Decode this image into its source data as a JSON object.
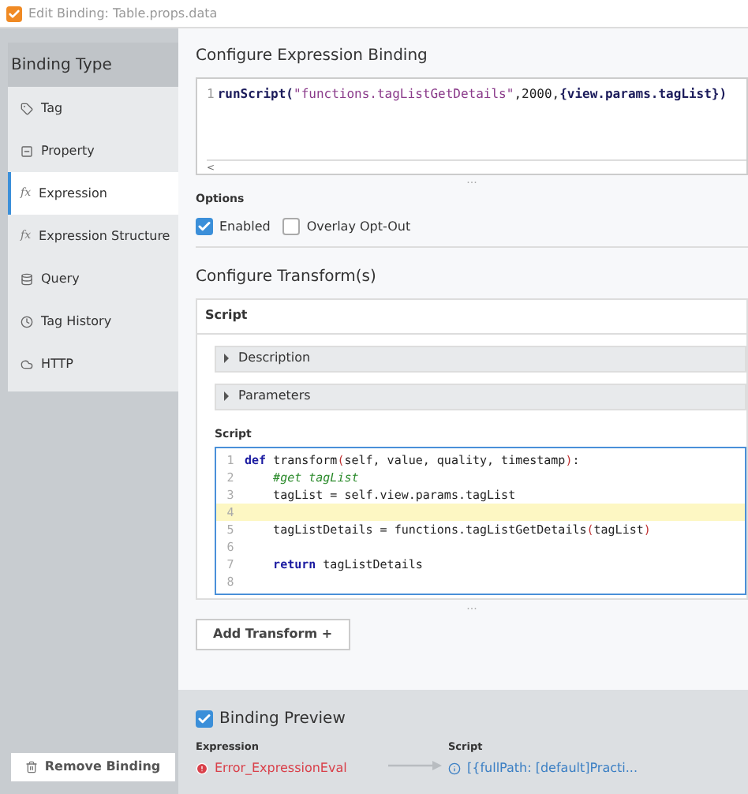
{
  "window": {
    "title": "Edit Binding: Table.props.data"
  },
  "sidebar": {
    "header": "Binding Type",
    "items": [
      {
        "label": "Tag",
        "selected": false
      },
      {
        "label": "Property",
        "selected": false
      },
      {
        "label": "Expression",
        "selected": true,
        "icon_text": "fx"
      },
      {
        "label": "Expression Structure",
        "selected": false,
        "icon_text": "fx"
      },
      {
        "label": "Query",
        "selected": false
      },
      {
        "label": "Tag History",
        "selected": false
      },
      {
        "label": "HTTP",
        "selected": false
      }
    ],
    "remove_button": "Remove Binding"
  },
  "expression_binding": {
    "title": "Configure Expression Binding",
    "lines": [
      {
        "number": "1",
        "tokens": [
          {
            "kind": "bold",
            "text": "runScript("
          },
          {
            "kind": "string",
            "text": "\"functions.tagListGetDetails\""
          },
          {
            "kind": "plain",
            "text": ",2000,"
          },
          {
            "kind": "bold",
            "text": "{view.params.tagList})"
          }
        ]
      }
    ],
    "scroll_arrow": "<",
    "resize_dots": "···"
  },
  "options": {
    "label": "Options",
    "checkboxes": [
      {
        "label": "Enabled",
        "checked": true
      },
      {
        "label": "Overlay Opt-Out",
        "checked": false
      }
    ]
  },
  "transforms": {
    "title": "Configure Transform(s)",
    "card_title": "Script",
    "sections": [
      {
        "label": "Description",
        "expanded": false
      },
      {
        "label": "Parameters",
        "expanded": false
      }
    ],
    "script_label": "Script",
    "lines": [
      {
        "number": "1",
        "highlighted": false,
        "tokens": [
          {
            "kind": "keyword",
            "text": "def "
          },
          {
            "kind": "plain",
            "text": "transform"
          },
          {
            "kind": "paren",
            "text": "("
          },
          {
            "kind": "plain",
            "text": "self, value, quality, timestamp"
          },
          {
            "kind": "paren",
            "text": ")"
          },
          {
            "kind": "plain",
            "text": ":"
          }
        ]
      },
      {
        "number": "2",
        "highlighted": false,
        "tokens": [
          {
            "kind": "comment",
            "text": "    #get tagList"
          }
        ]
      },
      {
        "number": "3",
        "highlighted": false,
        "tokens": [
          {
            "kind": "plain",
            "text": "    tagList = self.view.params.tagList"
          }
        ]
      },
      {
        "number": "4",
        "highlighted": true
      },
      {
        "number": "5",
        "highlighted": false,
        "tokens": [
          {
            "kind": "plain",
            "text": "    tagListDetails = functions.tagListGetDetails"
          },
          {
            "kind": "paren",
            "text": "("
          },
          {
            "kind": "plain",
            "text": "tagList"
          },
          {
            "kind": "paren",
            "text": ")"
          }
        ]
      },
      {
        "number": "6",
        "highlighted": false
      },
      {
        "number": "7",
        "highlighted": false,
        "tokens": [
          {
            "kind": "keyword",
            "text": "    return "
          },
          {
            "kind": "plain",
            "text": "tagListDetails"
          }
        ]
      },
      {
        "number": "8",
        "highlighted": false
      }
    ],
    "resize_dots": "···",
    "add_button": "Add Transform +"
  },
  "preview": {
    "title": "Binding Preview",
    "checked": true,
    "expression_label": "Expression",
    "expression_value": "Error_ExpressionEval",
    "script_label": "Script",
    "script_value": "[{fullPath: [default]Practi..."
  }
}
